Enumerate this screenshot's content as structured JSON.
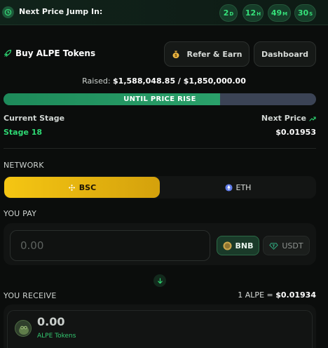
{
  "timer": {
    "label": "Next Price Jump In:",
    "days": "2",
    "days_unit": "D",
    "hours": "12",
    "hours_unit": "H",
    "minutes": "49",
    "minutes_unit": "M",
    "seconds": "30",
    "seconds_unit": "S"
  },
  "header": {
    "title": "Buy ALPE Tokens",
    "refer_label": "Refer & Earn",
    "dashboard_label": "Dashboard"
  },
  "raise": {
    "label": "Raised:",
    "amount": "$1,588,048.85 / $1,850,000.00",
    "progress_fraction": 0.6925,
    "progress_text": "UNTIL PRICE RISE"
  },
  "stage": {
    "current_label": "Current Stage",
    "current_value": "Stage 18",
    "next_label": "Next Price",
    "next_value": "$0.01953"
  },
  "network": {
    "label": "NETWORK",
    "options": [
      {
        "label": "BSC",
        "icon": "bsc-icon",
        "selected": true
      },
      {
        "label": "ETH",
        "icon": "eth-icon",
        "selected": false
      }
    ]
  },
  "pay": {
    "label": "YOU PAY",
    "amount_placeholder": "0.00",
    "currencies": [
      {
        "label": "BNB",
        "icon": "bnb-icon",
        "selected": true
      },
      {
        "label": "USDT",
        "icon": "usdt-icon",
        "selected": false
      }
    ]
  },
  "receive": {
    "label": "YOU RECEIVE",
    "rate_prefix": "1 ALPE =",
    "rate_value": "$0.01934",
    "amount": "0.00",
    "unit": "ALPE Tokens"
  },
  "colors": {
    "accent_green": "#2ed873",
    "bsc_yellow": "#f5c613",
    "progress_track": "#3b4355"
  }
}
